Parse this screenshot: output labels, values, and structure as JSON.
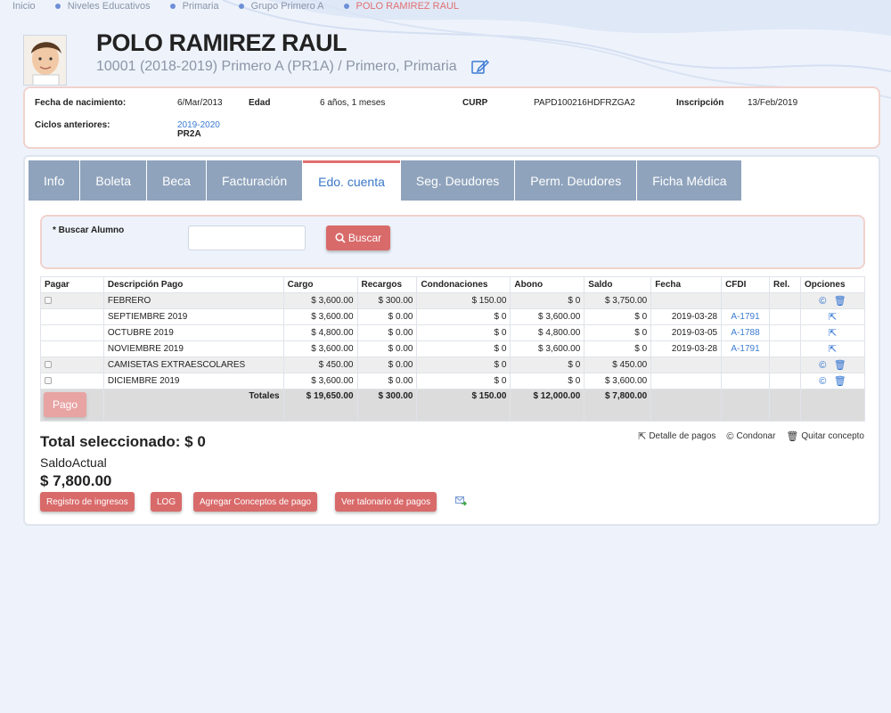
{
  "breadcrumb": [
    "Inicio",
    "Niveles Educativos",
    "Primaria",
    "Grupo Primero A",
    "POLO RAMIREZ RAUL"
  ],
  "student": {
    "name": "POLO RAMIREZ RAUL",
    "group": "10001 (2018-2019) Primero A (PR1A) / Primero, Primaria"
  },
  "info": {
    "birth_label": "Fecha de nacimiento:",
    "birth_value": "6/Mar/2013",
    "age_label": "Edad",
    "age_value": "6 años, 1 meses",
    "curp_label": "CURP",
    "curp_value": "PAPD100216HDFRZGA2",
    "enroll_label": "Inscripción",
    "enroll_value": "13/Feb/2019",
    "prev_label": "Ciclos anteriores:",
    "prev_cycle": "2019-2020",
    "prev_group": "PR2A"
  },
  "tabs": [
    "Info",
    "Boleta",
    "Beca",
    "Facturación",
    "Edo. cuenta",
    "Seg. Deudores",
    "Perm. Deudores",
    "Ficha Médica"
  ],
  "active_tab": "Edo. cuenta",
  "search": {
    "label": "* Buscar Alumno",
    "button": "Buscar",
    "value": ""
  },
  "table": {
    "headers": [
      "Pagar",
      "Descripción Pago",
      "Cargo",
      "Recargos",
      "Condonaciones",
      "Abono",
      "Saldo",
      "Fecha",
      "CFDI",
      "Rel.",
      "Opciones"
    ],
    "rows": [
      {
        "pagar": true,
        "desc": "FEBRERO",
        "cargo": "$ 3,600.00",
        "recargos": "$ 300.00",
        "condonaciones": "$ 150.00",
        "abono": "$ 0",
        "saldo": "$ 3,750.00",
        "fecha": "",
        "cfdi": "",
        "options": "condonar-quitar"
      },
      {
        "pagar": false,
        "desc": "SEPTIEMBRE 2019",
        "cargo": "$ 3,600.00",
        "recargos": "$ 0.00",
        "condonaciones": "$ 0",
        "abono": "$ 3,600.00",
        "saldo": "$ 0",
        "fecha": "2019-03-28",
        "cfdi": "A-1791",
        "options": "detalle"
      },
      {
        "pagar": false,
        "desc": "OCTUBRE 2019",
        "cargo": "$ 4,800.00",
        "recargos": "$ 0.00",
        "condonaciones": "$ 0",
        "abono": "$ 4,800.00",
        "saldo": "$ 0",
        "fecha": "2019-03-05",
        "cfdi": "A-1788",
        "options": "detalle"
      },
      {
        "pagar": false,
        "desc": "NOVIEMBRE 2019",
        "cargo": "$ 3,600.00",
        "recargos": "$ 0.00",
        "condonaciones": "$ 0",
        "abono": "$ 3,600.00",
        "saldo": "$ 0",
        "fecha": "2019-03-28",
        "cfdi": "A-1791",
        "options": "detalle"
      },
      {
        "pagar": true,
        "desc": "CAMISETAS EXTRAESCOLARES",
        "cargo": "$ 450.00",
        "recargos": "$ 0.00",
        "condonaciones": "$ 0",
        "abono": "$ 0",
        "saldo": "$ 450.00",
        "fecha": "",
        "cfdi": "",
        "options": "condonar-quitar"
      },
      {
        "pagar": true,
        "desc": "DICIEMBRE 2019",
        "cargo": "$ 3,600.00",
        "recargos": "$ 0.00",
        "condonaciones": "$ 0",
        "abono": "$ 0",
        "saldo": "$ 3,600.00",
        "fecha": "",
        "cfdi": "",
        "options": "condonar-quitar"
      }
    ],
    "totals": {
      "label": "Totales",
      "cargo": "$ 19,650.00",
      "recargos": "$ 300.00",
      "condonaciones": "$ 150.00",
      "abono": "$ 12,000.00",
      "saldo": "$ 7,800.00"
    }
  },
  "pago_button": "Pago",
  "total_selected": "Total seleccionado: $ 0",
  "saldo_label": "SaldoActual",
  "saldo_value": "$ 7,800.00",
  "legend": {
    "detalle": "Detalle de pagos",
    "condonar": "Condonar",
    "quitar": "Quitar concepto"
  },
  "actions": [
    "Registro de ingresos",
    "LOG",
    "Agregar Conceptos de pago",
    "Ver talonario de pagos"
  ],
  "colors": {
    "accent_red": "#d96a6a",
    "tab_bg": "#8fa3bc",
    "link_blue": "#3b7bd2"
  }
}
